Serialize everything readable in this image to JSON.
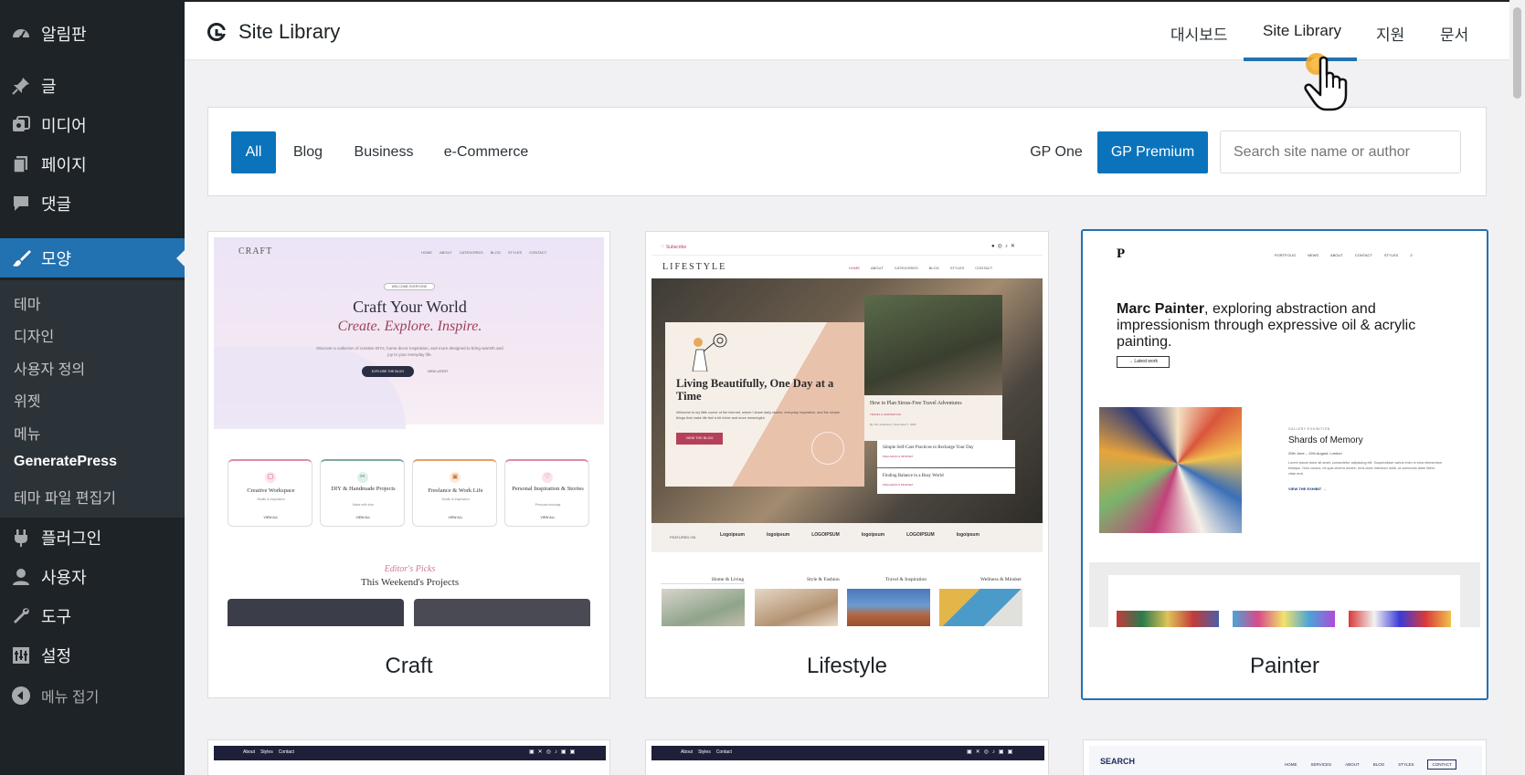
{
  "sidebar": {
    "items": [
      {
        "label": "알림판",
        "icon": "dashboard-icon"
      },
      {
        "label": "글",
        "icon": "pin-icon"
      },
      {
        "label": "미디어",
        "icon": "media-icon"
      },
      {
        "label": "페이지",
        "icon": "pages-icon"
      },
      {
        "label": "댓글",
        "icon": "comments-icon"
      },
      {
        "label": "모양",
        "icon": "appearance-icon"
      },
      {
        "label": "플러그인",
        "icon": "plugins-icon"
      },
      {
        "label": "사용자",
        "icon": "users-icon"
      },
      {
        "label": "도구",
        "icon": "tools-icon"
      },
      {
        "label": "설정",
        "icon": "settings-icon"
      },
      {
        "label": "메뉴 접기",
        "icon": "collapse-icon"
      }
    ],
    "submenu": [
      "테마",
      "디자인",
      "사용자 정의",
      "위젯",
      "메뉴",
      "GeneratePress",
      "테마 파일 편집기"
    ]
  },
  "header": {
    "title": "Site Library",
    "nav": [
      "대시보드",
      "Site Library",
      "지원",
      "문서"
    ]
  },
  "filters": {
    "categories": [
      "All",
      "Blog",
      "Business",
      "e-Commerce"
    ],
    "plans": [
      "GP One",
      "GP Premium"
    ],
    "search_placeholder": "Search site name or author"
  },
  "sites": [
    {
      "name": "Craft",
      "preview": {
        "logo": "CRAFT",
        "nav": [
          "HOME",
          "ABOUT",
          "CATEGORIES",
          "BLOG",
          "STYLES",
          "CONTACT"
        ],
        "badge": "WELCOME EVERYONE",
        "heading": "Craft Your World",
        "tagline": "Create. Explore. Inspire.",
        "desc": "Discover a collection of creative DIYs, home decor inspiration, and more designed to bring warmth and joy to your everyday life.",
        "btn1": "EXPLORE THE BLOG",
        "btn2": "VIEW LATEST",
        "cats": [
          {
            "title": "Creative Workspace",
            "sub": "Studio & Inspiration",
            "link": "VIEW ALL"
          },
          {
            "title": "DIY & Handmade Projects",
            "sub": "Made with love",
            "link": "VIEW ALL"
          },
          {
            "title": "Freelance & Work Life",
            "sub": "Studio & Inspiration",
            "link": "VIEW ALL"
          },
          {
            "title": "Personal Inspiration & Stories",
            "sub": "Personal musings",
            "link": "VIEW ALL"
          }
        ],
        "picks_script": "Editor's Picks",
        "picks_title": "This Weekend's Projects"
      }
    },
    {
      "name": "Lifestyle",
      "preview": {
        "subscribe": "♡ Subscribe",
        "logo": "LIFESTYLE",
        "nav": [
          "HOME",
          "ABOUT",
          "CATEGORIES",
          "BLOG",
          "STYLES",
          "CONTACT"
        ],
        "heading": "Living Beautifully, One Day at a Time",
        "desc": "Welcome to my little corner of the internet, where I share daily stories, everyday inspiration, and the simple things that make life feel a bit richer and more meaningful.",
        "cta": "VIEW THE BLOG",
        "card_title": "How to Plan Stress-Free Travel Adventures",
        "card_cat": "TRAVEL & INSPIRATION",
        "card_meta": "By Tom Anderson / November 7, 2025",
        "list1": "Simple Self-Care Practices to Recharge Your Day",
        "list1_cat": "WELLNESS & MINDSET",
        "list2": "Finding Balance in a Busy World",
        "list2_cat": "WELLNESS & MINDSET",
        "featured": "FEATURED ON",
        "logos": [
          "Logoipsum",
          "logoipsum",
          "LOGOIPSUM",
          "logoipsum",
          "LOGOIPSUM",
          "logoipsum"
        ],
        "cats": [
          "Home & Living",
          "Style & Fashion",
          "Travel & Inspiration",
          "Wellness & Mindset"
        ]
      }
    },
    {
      "name": "Painter",
      "preview": {
        "logo": "P",
        "nav": [
          "PORTFOLIO",
          "NEWS",
          "ABOUT",
          "CONTACT",
          "STYLES"
        ],
        "heading_bold": "Marc Painter",
        "heading_rest": ", exploring abstraction and impressionism through expressive oil & acrylic painting.",
        "btn": "→ Latest work",
        "exhibit_label": "GALLERY EXHIBITION",
        "exhibit_title": "Shards of Memory",
        "exhibit_dates": "20th June – 12th August, London",
        "exhibit_desc": "Lorem ipsum dolor sit amet, consectetur adipiscing elit. Suspendisse varius enim in eros elementum tristique. Duis cursus, mi quis viverra ornare, eros dolor interdum nulla, ut commodo diam libero vitae erat.",
        "exhibit_link": "VIEW THE EXHIBIT →"
      }
    }
  ],
  "second_row": {
    "top_nav": [
      "About",
      "Styles",
      "Contact"
    ],
    "search_logo": "SEARCH",
    "search_nav": [
      "HOME",
      "SERVICES",
      "ABOUT",
      "BLOG",
      "STYLES",
      "CONTACT"
    ]
  }
}
